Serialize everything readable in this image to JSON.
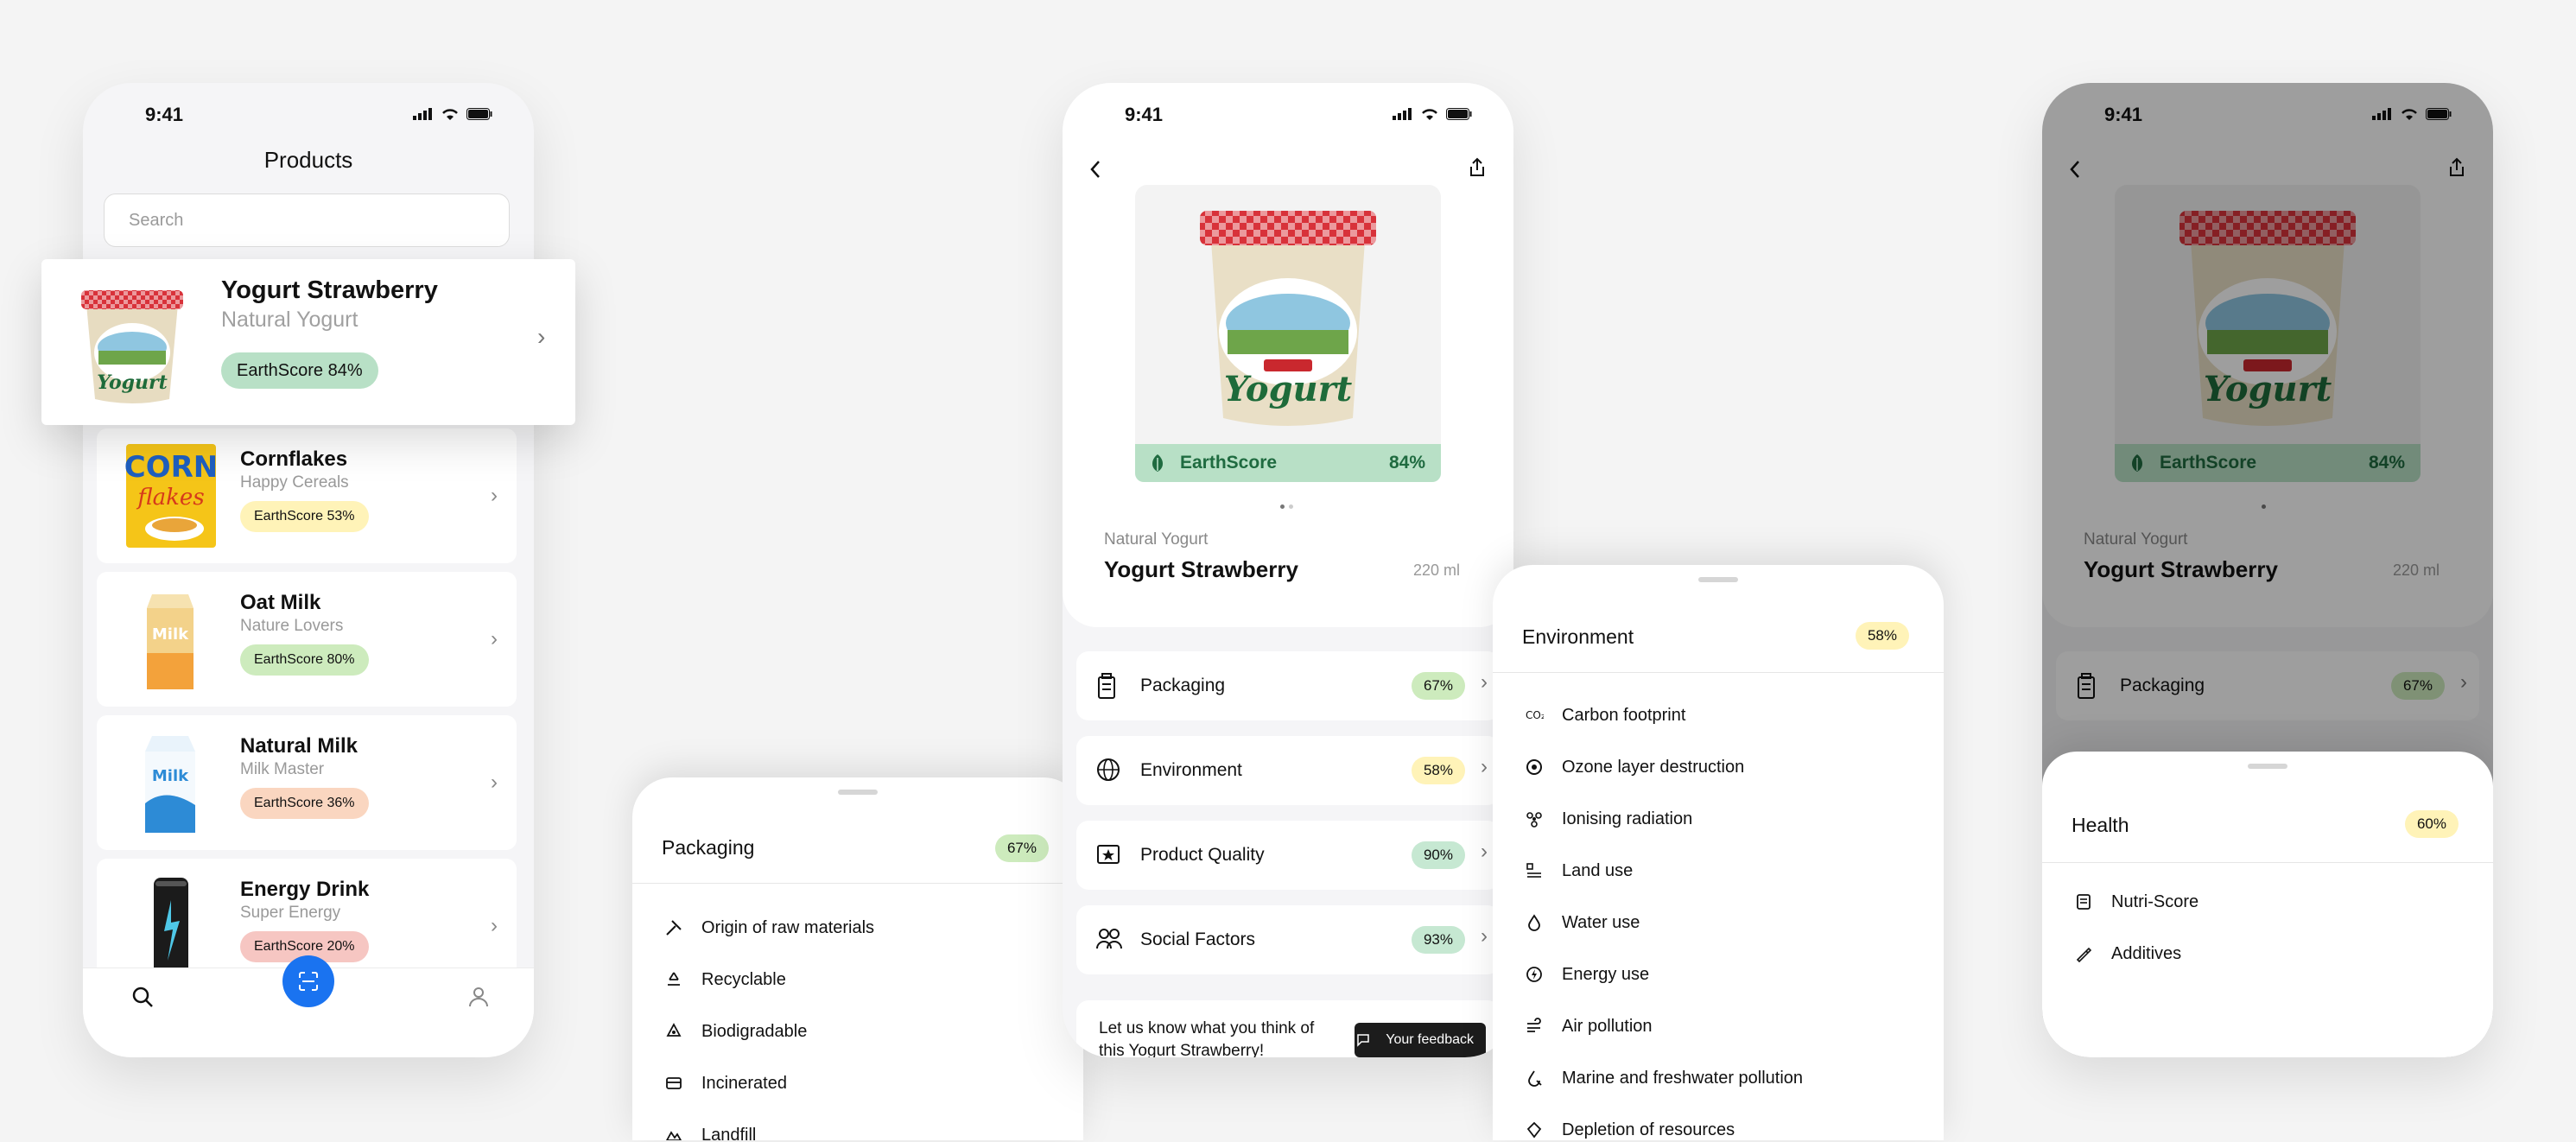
{
  "status": {
    "time": "9:41"
  },
  "list_screen": {
    "title": "Products",
    "search_placeholder": "Search",
    "featured": {
      "name": "Yogurt Strawberry",
      "brand": "Natural Yogurt",
      "score": "EarthScore 84%"
    },
    "items": [
      {
        "name": "Cornflakes",
        "brand": "Happy Cereals",
        "score": "EarthScore 53%",
        "color": "#fff3b8"
      },
      {
        "name": "Oat Milk",
        "brand": "Nature Lovers",
        "score": "EarthScore 80%",
        "color": "#cdebbd"
      },
      {
        "name": "Natural Milk",
        "brand": "Milk Master",
        "score": "EarthScore 36%",
        "color": "#fad6c0"
      },
      {
        "name": "Energy Drink",
        "brand": "Super Energy",
        "score": "EarthScore 20%",
        "color": "#f6c6c2"
      }
    ]
  },
  "detail_screen": {
    "earthscore_label": "EarthScore",
    "earthscore_value": "84%",
    "brand": "Natural Yogurt",
    "name": "Yogurt Strawberry",
    "size": "220 ml",
    "categories": [
      {
        "label": "Packaging",
        "value": "67%",
        "color": "#cdebbd"
      },
      {
        "label": "Environment",
        "value": "58%",
        "color": "#fff3b8"
      },
      {
        "label": "Product Quality",
        "value": "90%",
        "color": "#c6e8d2"
      },
      {
        "label": "Social Factors",
        "value": "93%",
        "color": "#c6e8d2"
      }
    ],
    "feedback_text": "Let us know what you think of this Yogurt Strawberry!",
    "feedback_button": "Your feedback"
  },
  "packaging_sheet": {
    "title": "Packaging",
    "value": "67%",
    "items": [
      "Origin of raw materials",
      "Recyclable",
      "Biodigradable",
      "Incinerated",
      "Landfill"
    ]
  },
  "environment_sheet": {
    "title": "Environment",
    "value": "58%",
    "items": [
      "Carbon footprint",
      "Ozone layer destruction",
      "Ionising radiation",
      "Land use",
      "Water use",
      "Energy use",
      "Air pollution",
      "Marine and freshwater pollution",
      "Depletion of resources"
    ]
  },
  "health_screen": {
    "earthscore_label": "EarthScore",
    "earthscore_value": "84%",
    "brand": "Natural Yogurt",
    "name": "Yogurt Strawberry",
    "size": "220 ml",
    "category": {
      "label": "Packaging",
      "value": "67%"
    },
    "sheet": {
      "title": "Health",
      "value": "60%",
      "items": [
        "Nutri-Score",
        "Additives"
      ]
    }
  }
}
